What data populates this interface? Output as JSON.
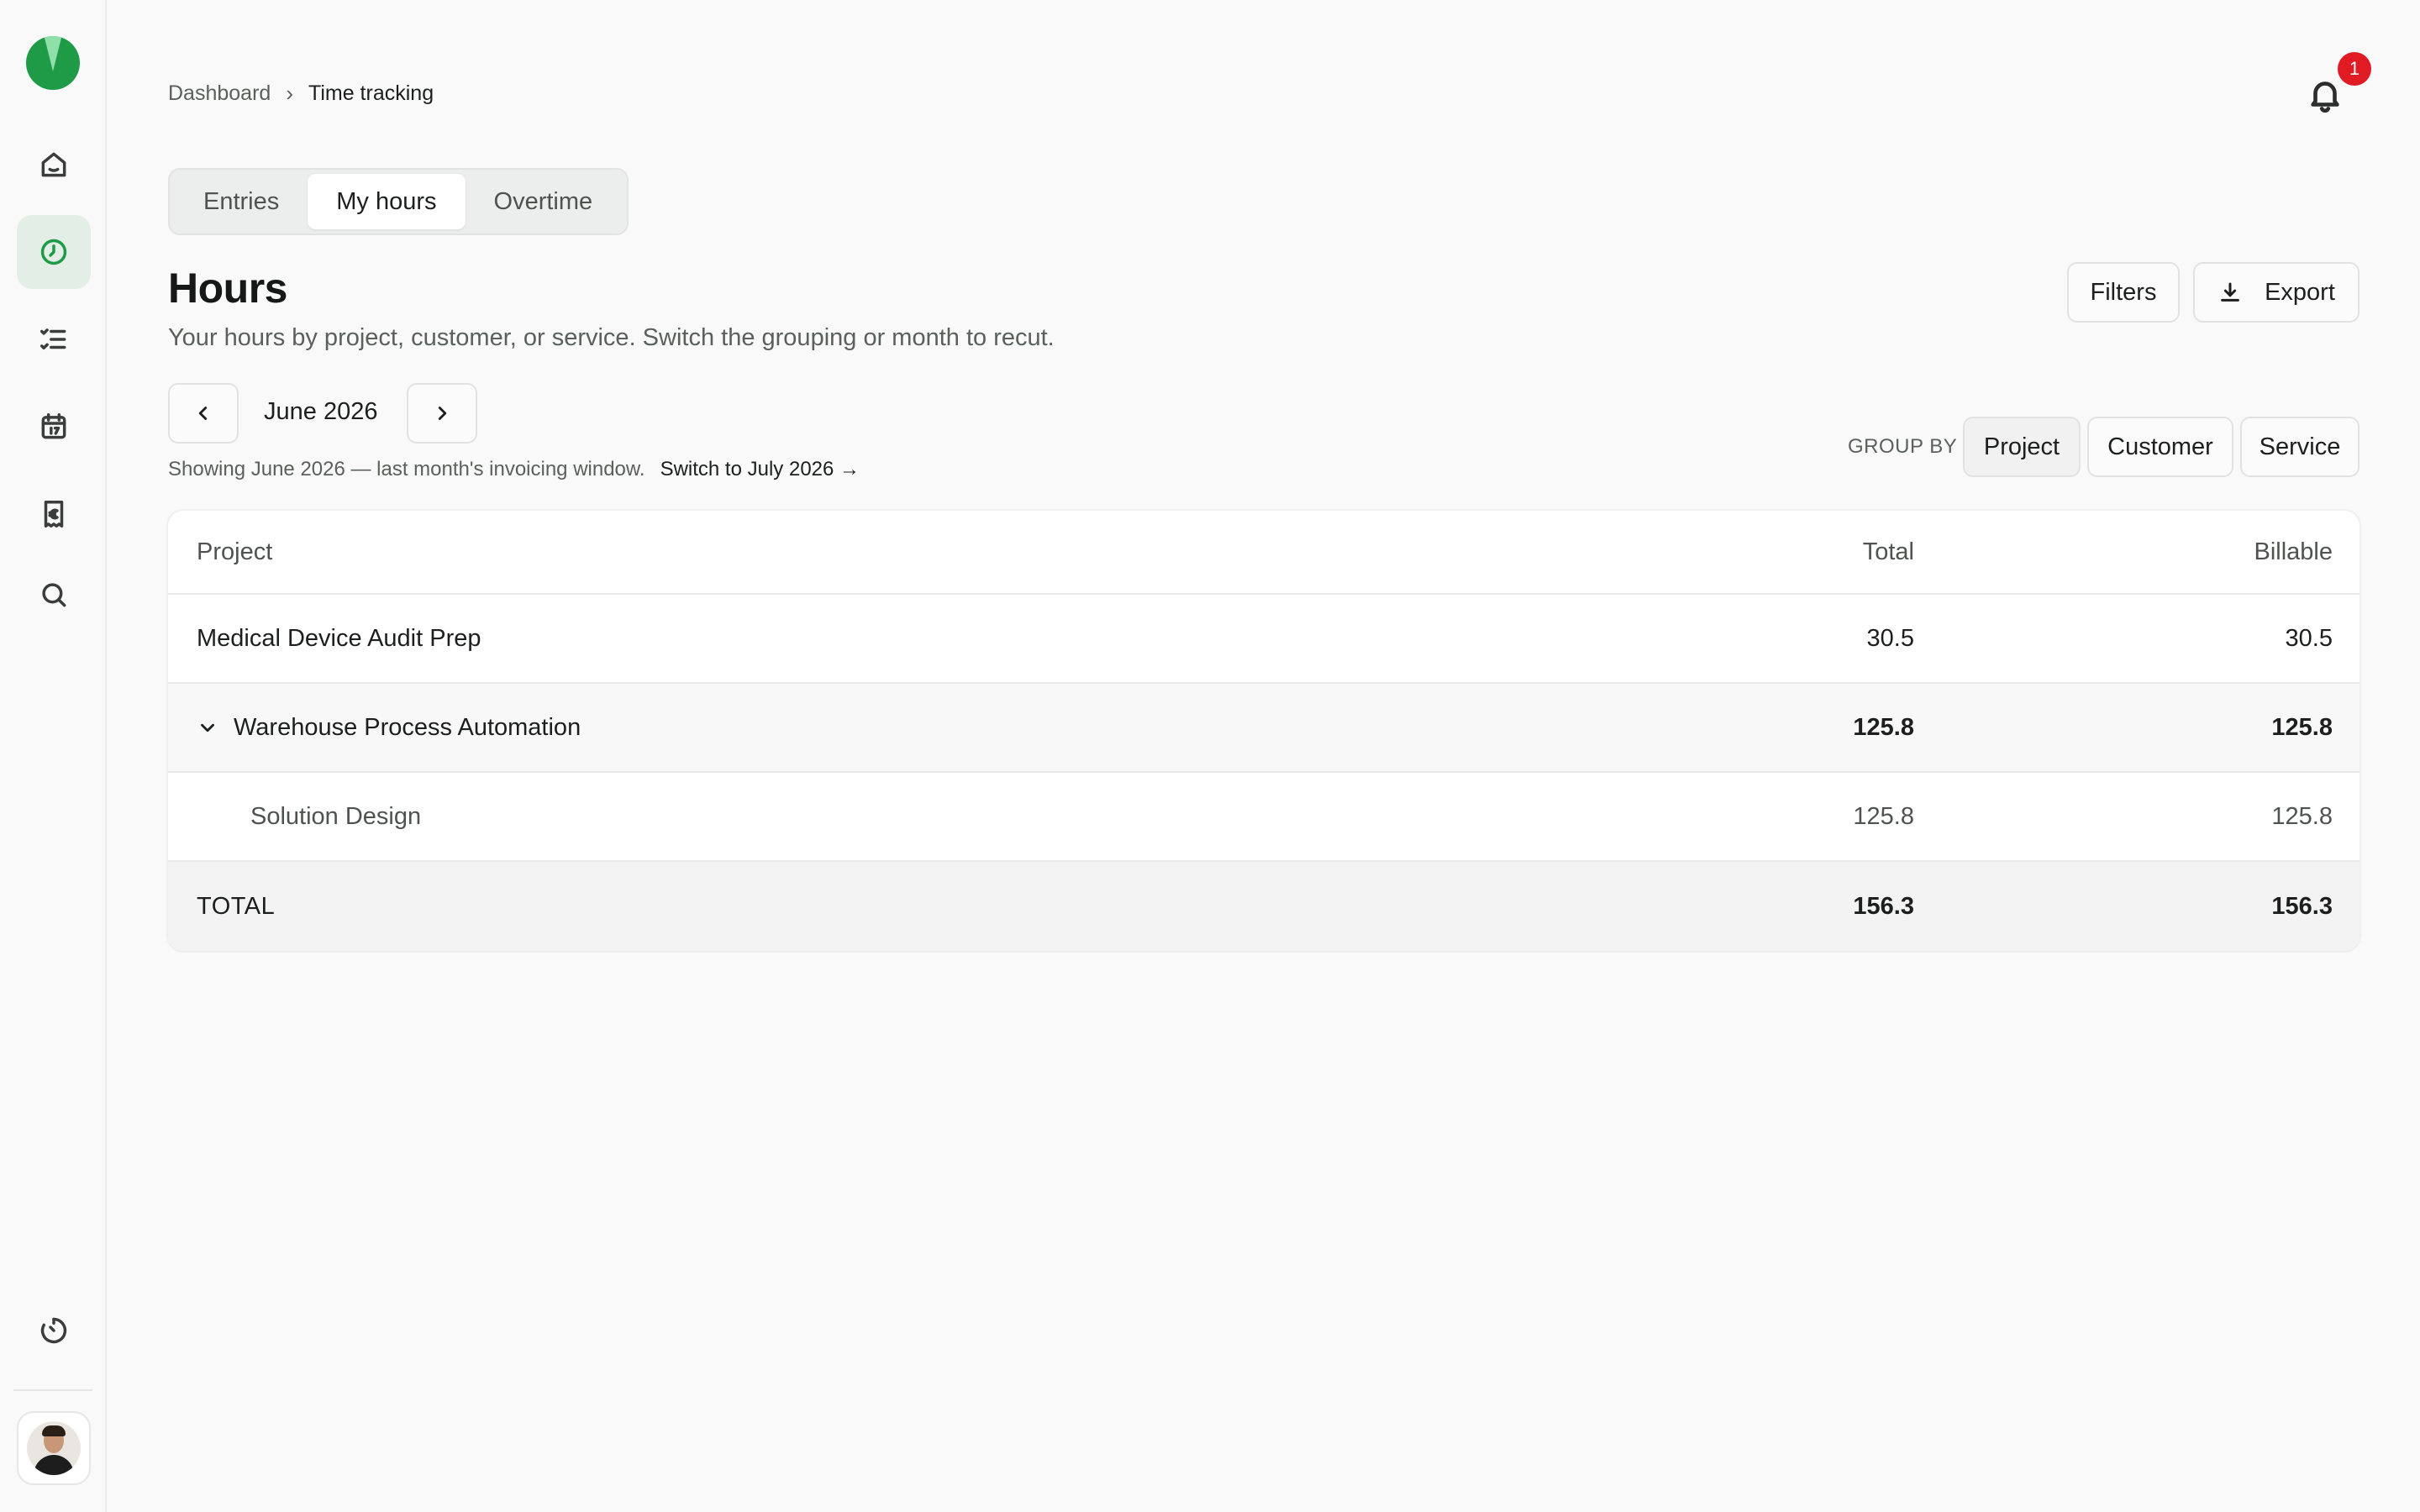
{
  "breadcrumb": {
    "root": "Dashboard",
    "separator": "›",
    "current": "Time tracking"
  },
  "notifications": {
    "count": "1",
    "icon": "bell-icon"
  },
  "tabs": [
    {
      "label": "Entries",
      "active": false
    },
    {
      "label": "My hours",
      "active": true
    },
    {
      "label": "Overtime",
      "active": false
    }
  ],
  "header": {
    "title": "Hours",
    "subtitle": "Your hours by project, customer, or service. Switch the grouping or month to recut.",
    "filters_label": "Filters",
    "export_label": "Export"
  },
  "month": {
    "label": "June 2026",
    "note": "Showing June 2026 — last month's invoicing window.",
    "switch_link": "Switch to July 2026 →"
  },
  "group_by": {
    "label": "GROUP BY",
    "options": [
      {
        "label": "Project",
        "active": true
      },
      {
        "label": "Customer",
        "active": false
      },
      {
        "label": "Service",
        "active": false
      }
    ]
  },
  "table": {
    "columns": {
      "name": "Project",
      "total": "Total",
      "billable": "Billable"
    },
    "rows": [
      {
        "name": "Medical Device Audit Prep",
        "total": "30.5",
        "billable": "30.5"
      },
      {
        "name": "Warehouse Process Automation",
        "total": "125.8",
        "billable": "125.8",
        "expanded": true
      },
      {
        "name": "Solution Design",
        "total": "125.8",
        "billable": "125.8",
        "child": true
      }
    ],
    "footer": {
      "name": "TOTAL",
      "total": "156.3",
      "billable": "156.3"
    }
  },
  "sidebar": {
    "items": [
      "home-icon",
      "clock-icon",
      "checklist-icon",
      "calendar-icon",
      "receipt-euro-icon",
      "search-icon"
    ],
    "active": "clock-icon",
    "bottom": "timer-icon"
  },
  "colors": {
    "accent": "#1f9b48",
    "badge": "#e01b24"
  }
}
